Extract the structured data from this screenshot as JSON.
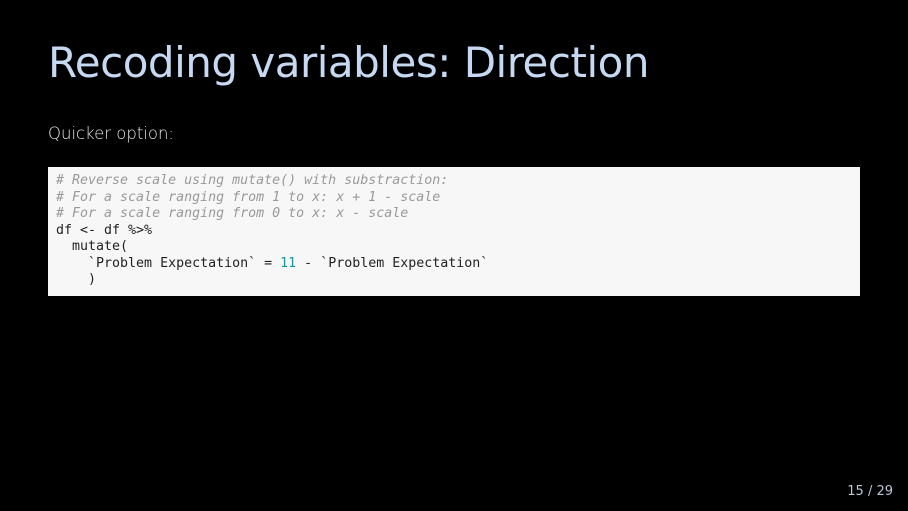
{
  "slide": {
    "title": "Recoding variables: Direction",
    "lead": "Quicker option:",
    "code": {
      "comment1": "# Reverse scale using mutate() with substraction:",
      "comment2": "# For a scale ranging from 1 to x: x + 1 - scale",
      "comment3": "# For a scale ranging from 0 to x: x - scale",
      "line4": "df <- df %>%",
      "line5": "  mutate(",
      "line6_pre": "    `Problem Expectation` = ",
      "line6_num": "11",
      "line6_post": " - `Problem Expectation`",
      "line7": "    )"
    },
    "page_number": "15 / 29"
  }
}
